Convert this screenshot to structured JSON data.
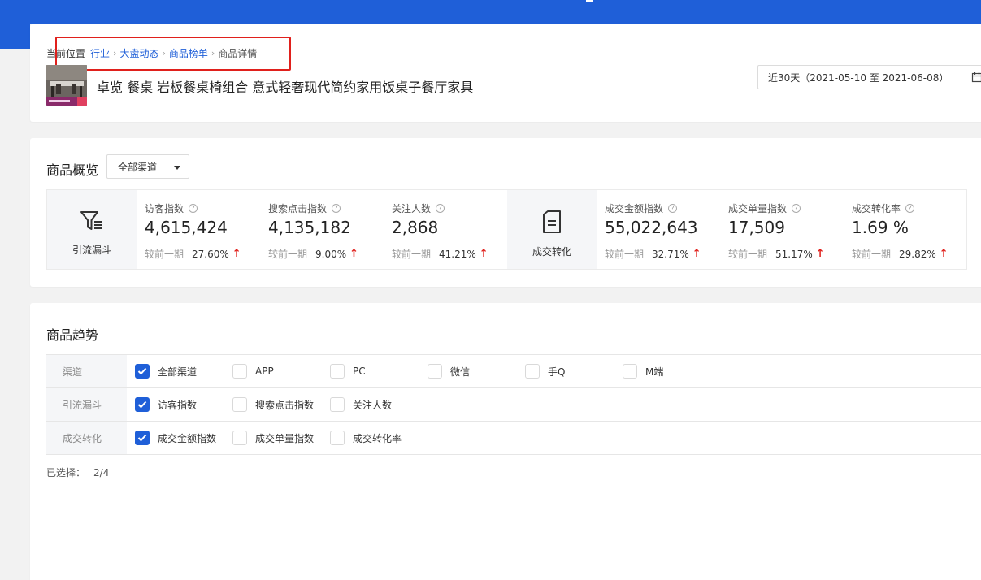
{
  "breadcrumb": {
    "label": "当前位置",
    "items": [
      "行业",
      "大盘动态",
      "商品榜单"
    ],
    "current": "商品详情"
  },
  "product": {
    "title": "卓览 餐桌 岩板餐桌椅组合 意式轻奢现代简约家用饭桌子餐厅家具"
  },
  "date_range": {
    "label": "近30天（2021-05-10 至 2021-06-08）"
  },
  "overview": {
    "title": "商品概览",
    "channel_value": "全部渠道",
    "groups": [
      {
        "name": "引流漏斗",
        "metrics": [
          {
            "label": "访客指数",
            "value": "4,615,424",
            "compare_label": "较前一期",
            "compare_value": "27.60%"
          },
          {
            "label": "搜索点击指数",
            "value": "4,135,182",
            "compare_label": "较前一期",
            "compare_value": "9.00%"
          },
          {
            "label": "关注人数",
            "value": "2,868",
            "compare_label": "较前一期",
            "compare_value": "41.21%"
          }
        ]
      },
      {
        "name": "成交转化",
        "metrics": [
          {
            "label": "成交金额指数",
            "value": "55,022,643",
            "compare_label": "较前一期",
            "compare_value": "32.71%"
          },
          {
            "label": "成交单量指数",
            "value": "17,509",
            "compare_label": "较前一期",
            "compare_value": "51.17%"
          },
          {
            "label": "成交转化率",
            "value": "1.69 %",
            "compare_label": "较前一期",
            "compare_value": "29.82%"
          }
        ]
      }
    ]
  },
  "trend": {
    "title": "商品趋势",
    "rows": [
      {
        "label": "渠道",
        "options": [
          {
            "label": "全部渠道",
            "checked": true
          },
          {
            "label": "APP",
            "checked": false
          },
          {
            "label": "PC",
            "checked": false
          },
          {
            "label": "微信",
            "checked": false
          },
          {
            "label": "手Q",
            "checked": false
          },
          {
            "label": "M端",
            "checked": false
          }
        ]
      },
      {
        "label": "引流漏斗",
        "options": [
          {
            "label": "访客指数",
            "checked": true
          },
          {
            "label": "搜索点击指数",
            "checked": false
          },
          {
            "label": "关注人数",
            "checked": false
          }
        ]
      },
      {
        "label": "成交转化",
        "options": [
          {
            "label": "成交金额指数",
            "checked": true
          },
          {
            "label": "成交单量指数",
            "checked": false
          },
          {
            "label": "成交转化率",
            "checked": false
          }
        ]
      }
    ],
    "selected_label": "已选择：",
    "selected_count": "2/4"
  },
  "colors": {
    "brand": "#1f5fd8",
    "up_arrow": "#e0201c",
    "highlight_box": "#e0201c"
  }
}
